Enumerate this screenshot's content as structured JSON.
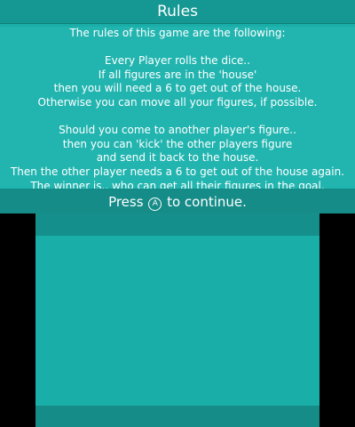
{
  "top_screen": {
    "title": "Rules",
    "rules_lines": [
      "The rules of this game are the following:",
      "",
      "Every Player rolls the dice..",
      "If all figures are in the 'house'",
      "then you will need a 6 to get out of the house.",
      "Otherwise you can move all your figures, if possible.",
      "",
      "Should you come to another player's figure..",
      "then you can 'kick' the other players figure",
      "and send it back to the house.",
      "Then the other player needs a 6 to get out of the house again.",
      "The winner is.. who can get all their figures in the goal."
    ]
  },
  "prompt": {
    "before": "Press",
    "button_glyph": "A",
    "after": "to continue."
  },
  "colors": {
    "teal_light": "#22b5b0",
    "teal_mid": "#1aaea9",
    "teal_dark": "#168c88",
    "letterbox": "#000000",
    "text": "#ffffff"
  },
  "icons": {
    "a_button": "a-button-icon"
  }
}
